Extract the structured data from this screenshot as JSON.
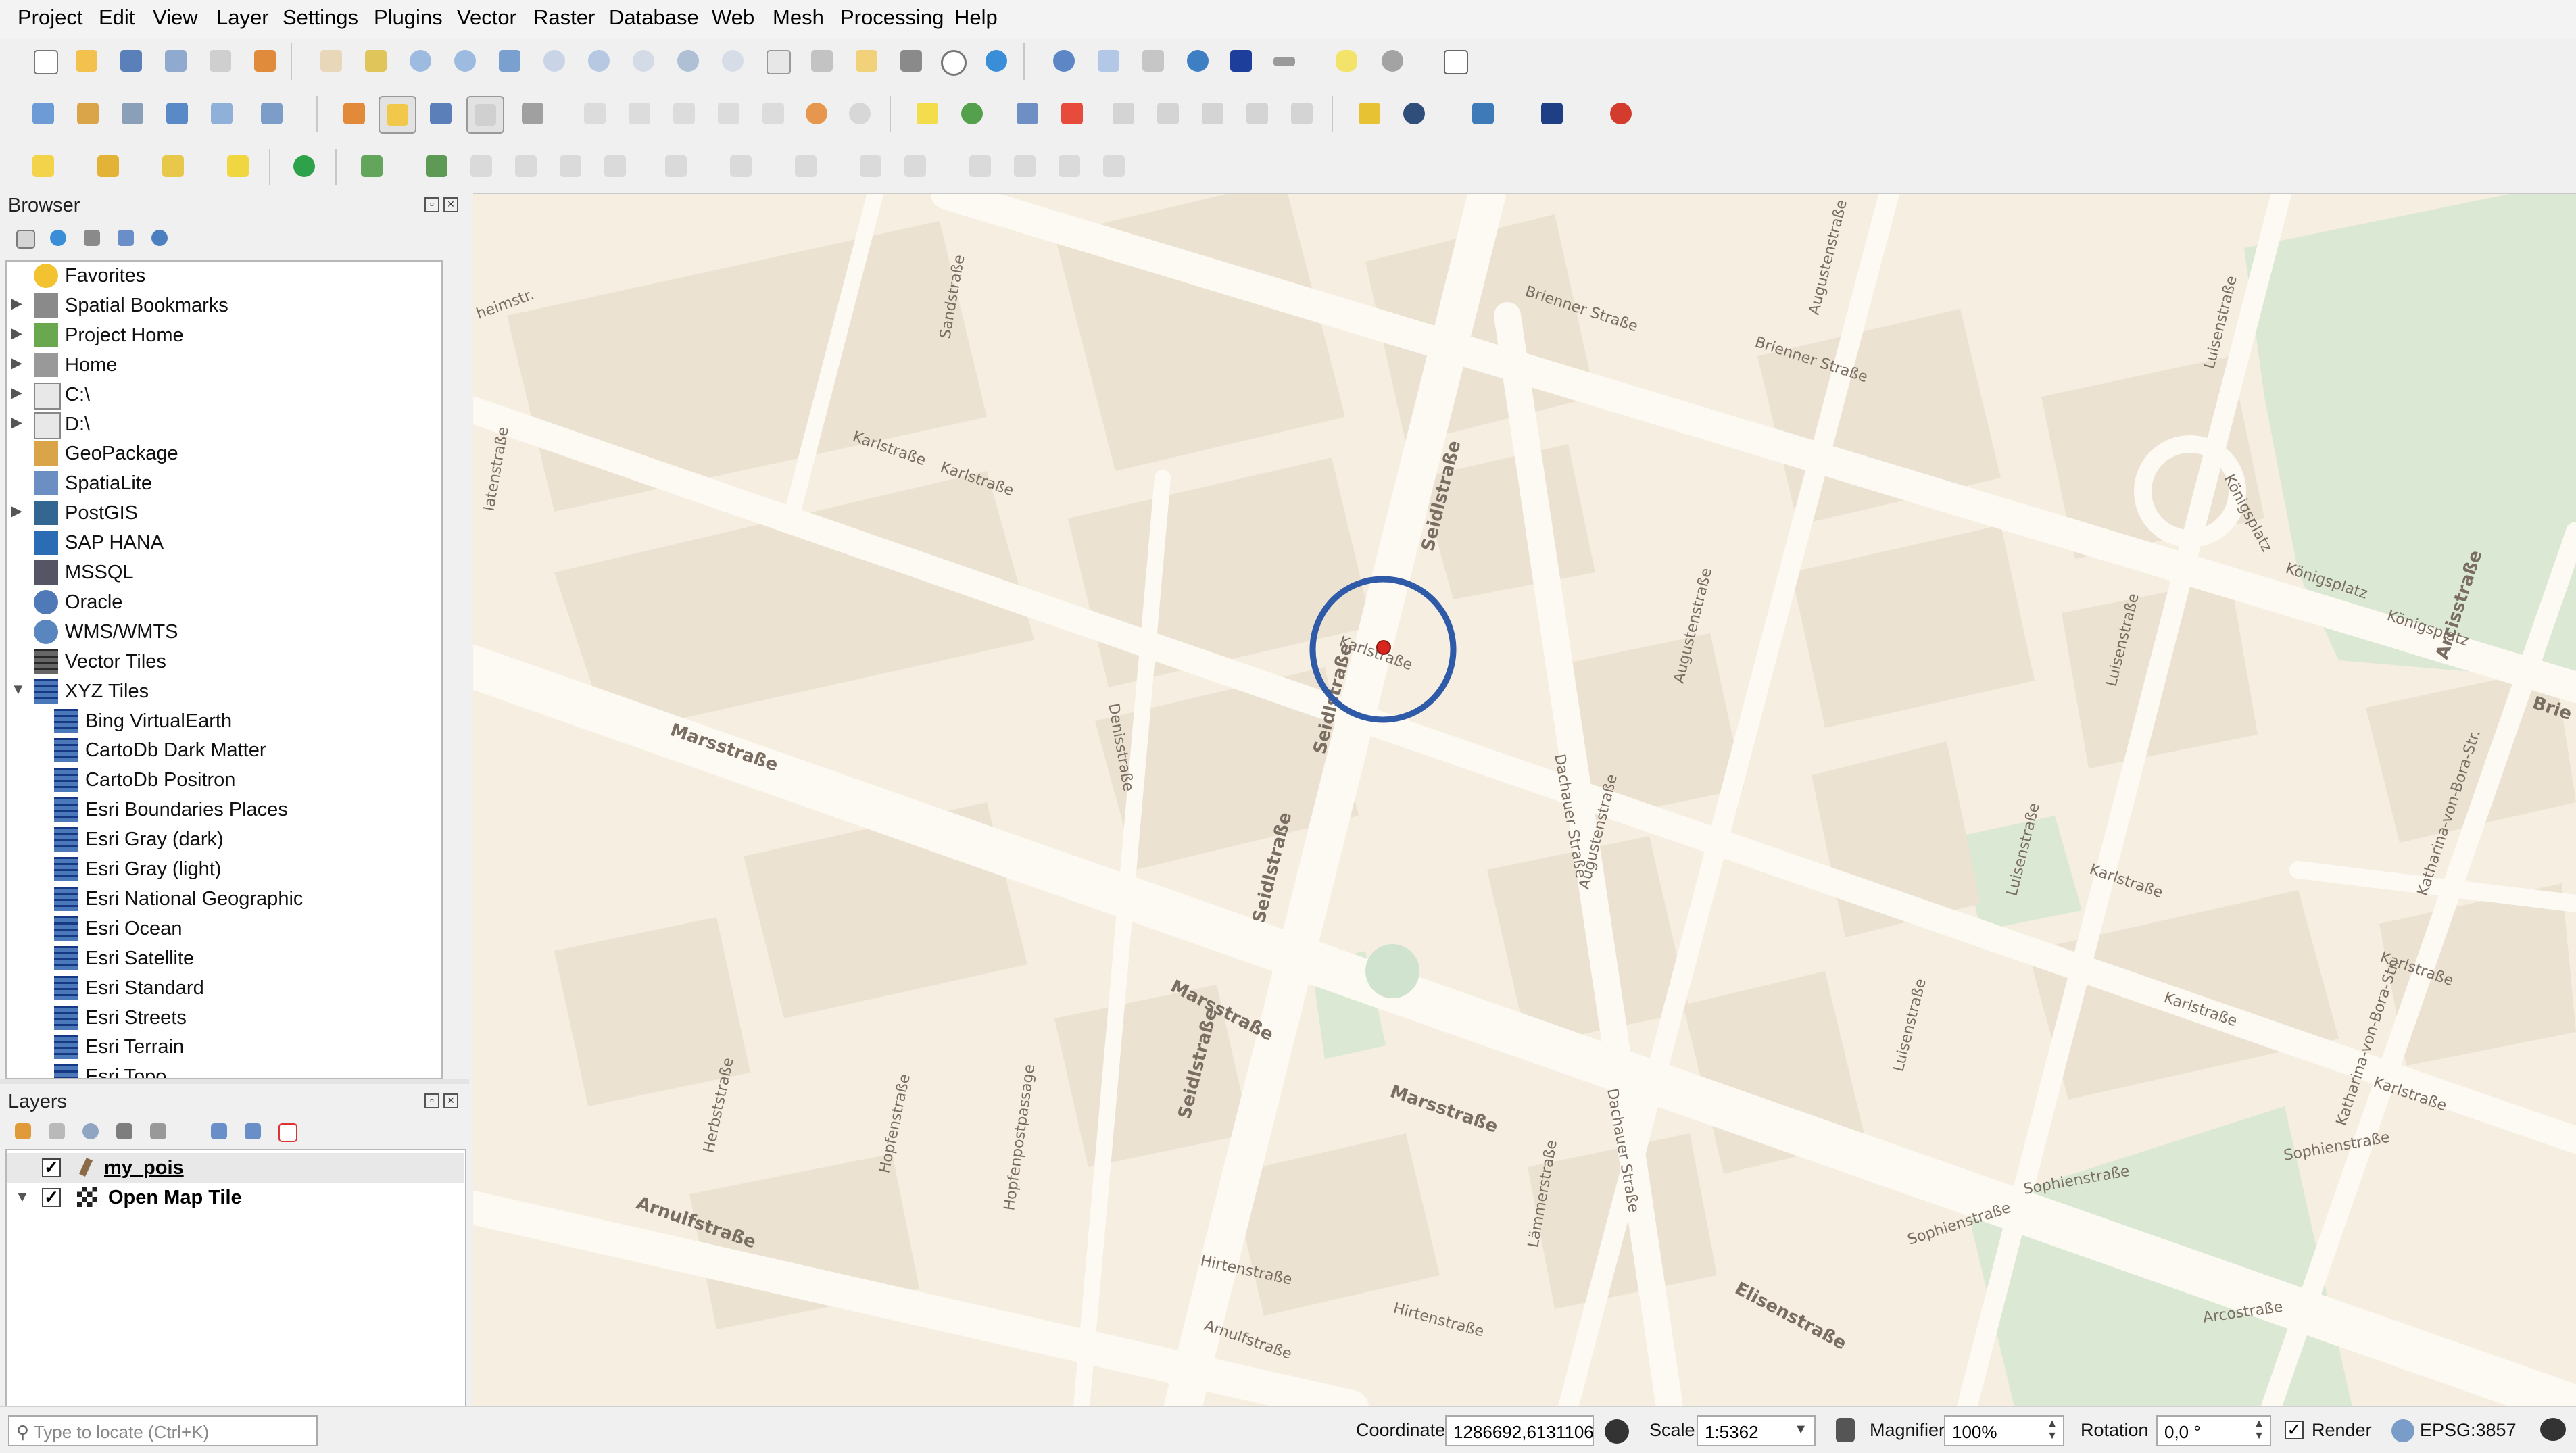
{
  "menu": [
    "Project",
    "Edit",
    "View",
    "Layer",
    "Settings",
    "Plugins",
    "Vector",
    "Raster",
    "Database",
    "Web",
    "Mesh",
    "Processing",
    "Help"
  ],
  "browser": {
    "title": "Browser",
    "items": [
      {
        "label": "Favorites",
        "icon": "star-icon",
        "expand": "none",
        "indent": 0
      },
      {
        "label": "Spatial Bookmarks",
        "icon": "bookmark-icon",
        "expand": "collapsed",
        "indent": 0
      },
      {
        "label": "Project Home",
        "icon": "project-home-icon",
        "expand": "collapsed",
        "indent": 0
      },
      {
        "label": "Home",
        "icon": "home-icon",
        "expand": "collapsed",
        "indent": 0
      },
      {
        "label": "C:\\",
        "icon": "folder-icon",
        "expand": "collapsed",
        "indent": 0
      },
      {
        "label": "D:\\",
        "icon": "folder-icon",
        "expand": "collapsed",
        "indent": 0
      },
      {
        "label": "GeoPackage",
        "icon": "geopackage-icon",
        "expand": "none",
        "indent": 0
      },
      {
        "label": "SpatiaLite",
        "icon": "spatialite-icon",
        "expand": "none",
        "indent": 0
      },
      {
        "label": "PostGIS",
        "icon": "postgis-icon",
        "expand": "collapsed",
        "indent": 0
      },
      {
        "label": "SAP HANA",
        "icon": "sap-hana-icon",
        "expand": "none",
        "indent": 0
      },
      {
        "label": "MSSQL",
        "icon": "mssql-icon",
        "expand": "none",
        "indent": 0
      },
      {
        "label": "Oracle",
        "icon": "oracle-icon",
        "expand": "none",
        "indent": 0
      },
      {
        "label": "WMS/WMTS",
        "icon": "globe-icon",
        "expand": "none",
        "indent": 0
      },
      {
        "label": "Vector Tiles",
        "icon": "vector-tiles-icon",
        "expand": "none",
        "indent": 0
      },
      {
        "label": "XYZ Tiles",
        "icon": "xyz-tiles-icon",
        "expand": "expanded",
        "indent": 0
      },
      {
        "label": "Bing VirtualEarth",
        "icon": "tile-grid-icon",
        "expand": "none",
        "indent": 1
      },
      {
        "label": "CartoDb Dark Matter",
        "icon": "tile-grid-icon",
        "expand": "none",
        "indent": 1
      },
      {
        "label": "CartoDb Positron",
        "icon": "tile-grid-icon",
        "expand": "none",
        "indent": 1
      },
      {
        "label": "Esri Boundaries Places",
        "icon": "tile-grid-icon",
        "expand": "none",
        "indent": 1
      },
      {
        "label": "Esri Gray (dark)",
        "icon": "tile-grid-icon",
        "expand": "none",
        "indent": 1
      },
      {
        "label": "Esri Gray (light)",
        "icon": "tile-grid-icon",
        "expand": "none",
        "indent": 1
      },
      {
        "label": "Esri National Geographic",
        "icon": "tile-grid-icon",
        "expand": "none",
        "indent": 1
      },
      {
        "label": "Esri Ocean",
        "icon": "tile-grid-icon",
        "expand": "none",
        "indent": 1
      },
      {
        "label": "Esri Satellite",
        "icon": "tile-grid-icon",
        "expand": "none",
        "indent": 1
      },
      {
        "label": "Esri Standard",
        "icon": "tile-grid-icon",
        "expand": "none",
        "indent": 1
      },
      {
        "label": "Esri Streets",
        "icon": "tile-grid-icon",
        "expand": "none",
        "indent": 1
      },
      {
        "label": "Esri Terrain",
        "icon": "tile-grid-icon",
        "expand": "none",
        "indent": 1
      },
      {
        "label": "Esri Topo",
        "icon": "tile-grid-icon",
        "expand": "none",
        "indent": 1
      }
    ]
  },
  "layers": {
    "title": "Layers",
    "items": [
      {
        "label": "my_pois",
        "checked": true,
        "icon": "point-layer-icon",
        "underline": true,
        "expand": "none"
      },
      {
        "label": "Open Map Tile",
        "checked": true,
        "icon": "raster-layer-icon",
        "underline": false,
        "expand": "expanded"
      }
    ]
  },
  "map": {
    "streets": [
      "Karlstraße",
      "Karlstraße",
      "Karlstraße",
      "Karlstraße",
      "Karlstraße",
      "Karlstraße",
      "Karlstraße",
      "Brienner Straße",
      "Brienner Straße",
      "Augustenstraße",
      "Augustenstraße",
      "Augustenstraße",
      "Luisenstraße",
      "Luisenstraße",
      "Luisenstraße",
      "Luisenstraße",
      "Seidlstraße",
      "Seidlstraße",
      "Seidlstraße",
      "Seidlstraße",
      "Marsstraße",
      "Marsstraße",
      "Marsstraße",
      "Dachauer Straße",
      "Dachauer Straße",
      "Denisstraße",
      "Sandstraße",
      "Königsplatz",
      "Königsplatz",
      "Königsplatz",
      "Arcisstraße",
      "Katharina-von-Bora-Str.",
      "Katharina-von-Bora-Str.",
      "Sophienstraße",
      "Sophienstraße",
      "Sophienstraße",
      "Elisenstraße",
      "Arnulfstraße",
      "Arnulfstraße",
      "Hirtenstraße",
      "Hirtenstraße",
      "Herbststraße",
      "Hopfenstraße",
      "Hopfenpostpassage",
      "Lämmerstraße",
      "Arcostraße",
      "Brie",
      "heimstr.",
      "latenstraße"
    ],
    "colors": {
      "background": "#f5eee1",
      "building": "#ece2d2",
      "road": "#fdfaf3",
      "park": "#dbe8d4",
      "highlight": "#2e5aa8",
      "poi": "#d7261e"
    }
  },
  "search": {
    "placeholder": "Type to locate (Ctrl+K)"
  },
  "status": {
    "coordinate_label": "Coordinate",
    "coordinate": "1286692,6131106",
    "scale_label": "Scale",
    "scale": "1:5362",
    "magnifier_label": "Magnifier",
    "magnifier": "100%",
    "rotation_label": "Rotation",
    "rotation": "0,0 °",
    "render_label": "Render",
    "crs": "EPSG:3857"
  }
}
